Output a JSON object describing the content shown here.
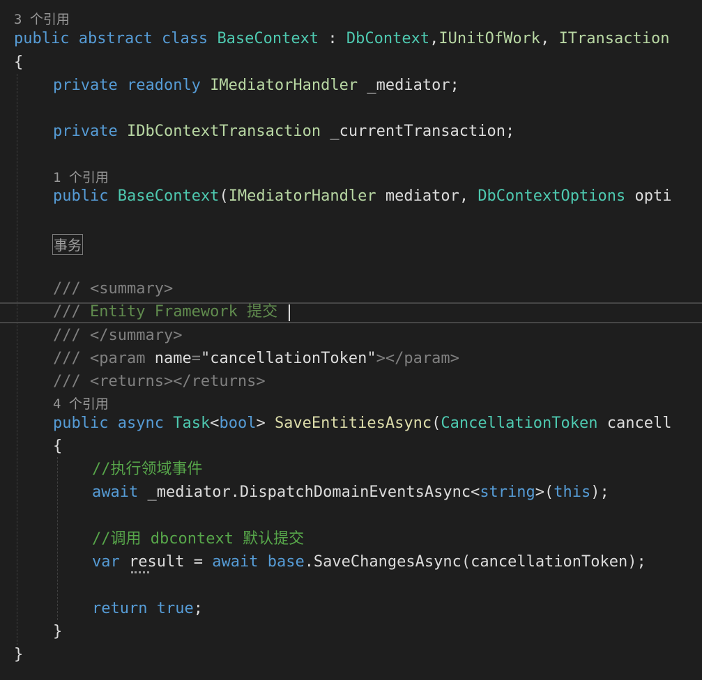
{
  "code": {
    "class_ref_count": "3 个引用",
    "class_decl": {
      "kw_public": "public",
      "kw_abstract": "abstract",
      "kw_class": "class",
      "class_name": "BaseContext",
      "colon": " : ",
      "base_class": "DbContext",
      "comma1": ",",
      "iface_uow": "IUnitOfWork",
      "comma2": ", ",
      "iface_transaction": "ITransaction"
    },
    "open_brace_class": "{",
    "field_mediator": {
      "kw_private": "private",
      "kw_readonly": "readonly",
      "type": "IMediatorHandler",
      "name": " _mediator;"
    },
    "field_transaction": {
      "kw_private": "private",
      "type": "IDbContextTransaction",
      "name": " _currentTransaction;"
    },
    "ctor_ref_count": "1 个引用",
    "ctor_decl": {
      "kw_public": "public",
      "name": "BaseContext",
      "open_paren": "(",
      "param1_type": "IMediatorHandler",
      "param1_name": " mediator, ",
      "param2_type": "DbContextOptions",
      "param2_name": " opti"
    },
    "region_label": "事务",
    "doc_summary_open": {
      "slashes": "/// ",
      "tag": "<summary>"
    },
    "doc_summary_text": {
      "slashes": "/// ",
      "text": "Entity Framework 提交"
    },
    "doc_summary_close": {
      "slashes": "/// ",
      "tag": "</summary>"
    },
    "doc_param": {
      "slashes": "/// ",
      "tag_open": "<param",
      "attr_name": " name",
      "equals": "=",
      "attr_value": "\"cancellationToken\"",
      "tag_mid": "></param>"
    },
    "doc_returns": {
      "slashes": "/// ",
      "tag": "<returns></returns>"
    },
    "method_ref_count": "4 个引用",
    "method_decl": {
      "kw_public": "public",
      "kw_async": "async",
      "type_task": "Task",
      "lt": "<",
      "type_bool": "bool",
      "gt": "> ",
      "name": "SaveEntitiesAsync",
      "open_paren": "(",
      "param_type": "CancellationToken",
      "param_name": " cancell"
    },
    "open_brace_method": "{",
    "comment_dispatch": "//执行领域事件",
    "await_dispatch": {
      "kw_await": "await",
      "call": " _mediator.DispatchDomainEventsAsync",
      "lt": "<",
      "type_string": "string",
      "gt_paren": ">(",
      "kw_this": "this",
      "end": ");"
    },
    "comment_save": "//调用 dbcontext 默认提交",
    "save_stmt": {
      "kw_var": "var",
      "var_name": " result",
      "equals": " = ",
      "kw_await": "await",
      "space": " ",
      "kw_base": "base",
      "call": ".SaveChangesAsync(cancellationToken);"
    },
    "return_stmt": {
      "kw_return": "return",
      "space": " ",
      "kw_true": "true",
      "semi": ";"
    },
    "close_brace_method": "}",
    "close_brace_class": "}"
  },
  "colors": {
    "background": "#1e1e1e",
    "keyword": "#569cd6",
    "type": "#4ec9b0",
    "interface": "#b8d7a3",
    "comment": "#57a64a",
    "xml_doc": "#608b4e",
    "xml_delimiter": "#808080",
    "string": "#d69d85",
    "plain": "#dcdcdc",
    "codelens": "#999999"
  }
}
